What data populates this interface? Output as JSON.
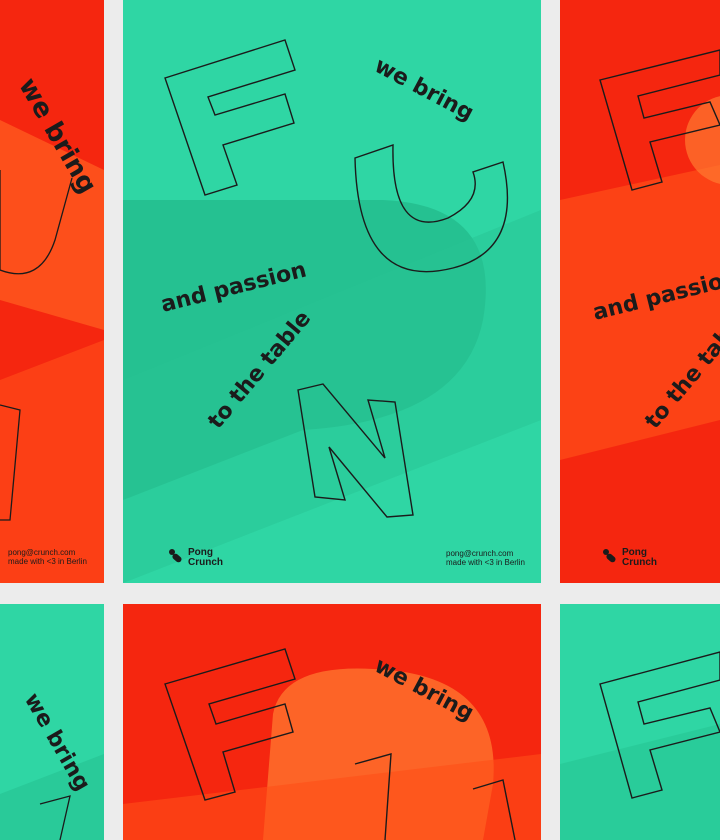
{
  "colors": {
    "green": "#2fd6a4",
    "red": "#f5260f",
    "ink": "#1b1b1b",
    "gap": "#ececec"
  },
  "poster": {
    "big_letters": [
      "F",
      "U",
      "N"
    ],
    "line1": "we bring",
    "line2": "and passion",
    "line3": "to the table",
    "email": "pong@crunch.com",
    "made_with": "made with <3 in Berlin",
    "brand_top": "Pong",
    "brand_bottom": "Crunch"
  }
}
